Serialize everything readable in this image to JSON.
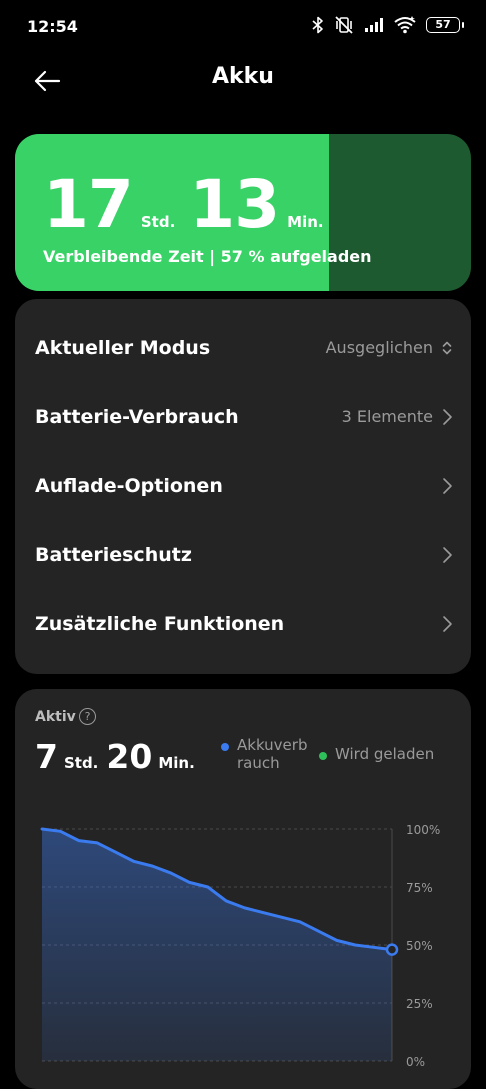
{
  "status": {
    "time": "12:54",
    "battery_level": "57"
  },
  "header": {
    "title": "Akku"
  },
  "battery": {
    "hours": "17",
    "hours_unit": "Std.",
    "minutes": "13",
    "minutes_unit": "Min.",
    "subtitle": "Verbleibende Zeit | 57 % aufgeladen",
    "charge_fraction": 0.688,
    "color_fill": "#38d266",
    "color_track": "#1e5a2f"
  },
  "settings": {
    "mode_label": "Aktueller Modus",
    "mode_value": "Ausgeglichen",
    "usage_label": "Batterie-Verbrauch",
    "usage_value": "3 Elemente",
    "charging_label": "Auflade-Optionen",
    "protection_label": "Batterieschutz",
    "extra_label": "Zusätzliche Funktionen"
  },
  "usage": {
    "label": "Aktiv",
    "help_glyph": "?",
    "hours": "7",
    "hours_unit": "Std.",
    "minutes": "20",
    "minutes_unit": "Min.",
    "legend_usage": "Akkuverb\nrauch",
    "legend_charging": "Wird geladen",
    "color_usage": "#3b7bf0",
    "color_charging": "#2fbf5a"
  },
  "chart_data": {
    "type": "area",
    "y_ticks": [
      "100%",
      "75%",
      "50%",
      "25%",
      "0%"
    ],
    "ylim": [
      0,
      100
    ],
    "x": [
      0,
      1,
      2,
      3,
      4,
      5,
      6,
      7,
      8,
      9,
      10,
      11,
      12,
      13,
      14,
      15,
      16,
      17,
      18,
      19
    ],
    "series": [
      {
        "name": "Akkuverbrauch",
        "values": [
          100,
          99,
          95,
          94,
          90,
          86,
          84,
          81,
          77,
          75,
          69,
          66,
          64,
          62,
          60,
          56,
          52,
          50,
          49,
          48
        ]
      }
    ]
  }
}
